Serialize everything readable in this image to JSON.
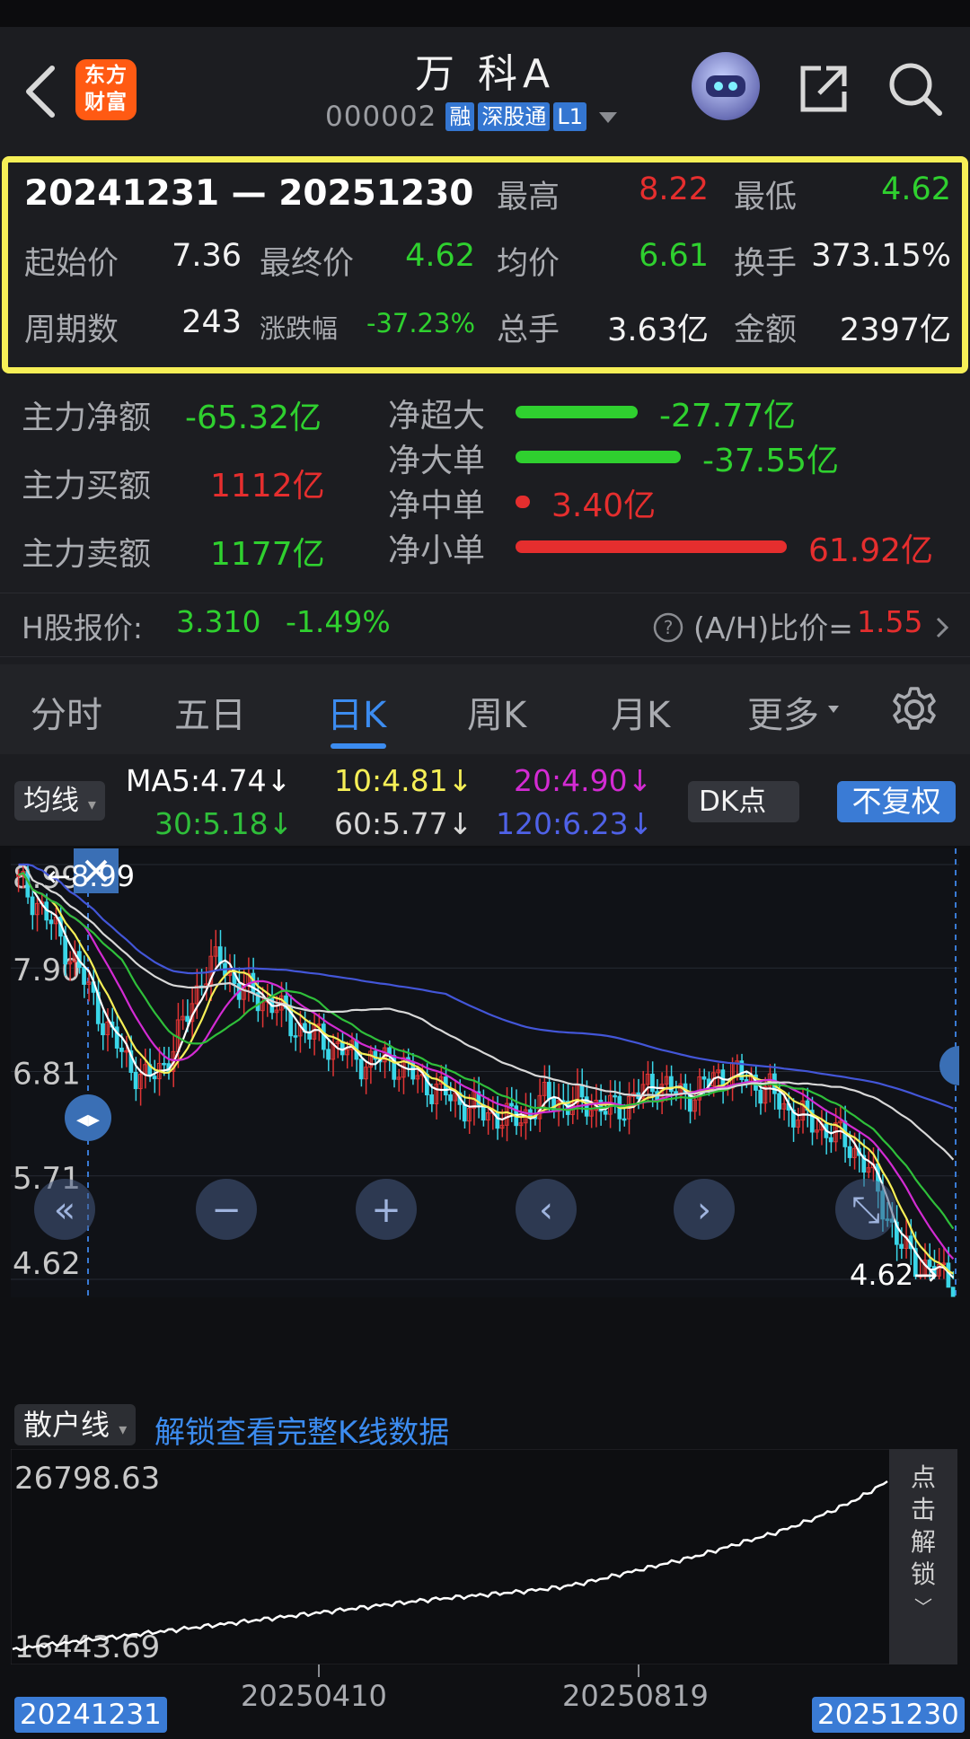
{
  "header": {
    "logo_line1": "东方",
    "logo_line2": "财富",
    "stock_name": "万 科A",
    "stock_code": "000002",
    "tags": [
      "融",
      "深股通",
      "L1"
    ]
  },
  "range": {
    "dates": "20241231 — 20251230",
    "high_label": "最高",
    "high": "8.22",
    "low_label": "最低",
    "low": "4.62",
    "start_label": "起始价",
    "start": "7.36",
    "end_label": "最终价",
    "end": "4.62",
    "avg_label": "均价",
    "avg": "6.61",
    "turnover_label": "换手",
    "turnover": "373.15%",
    "periods_label": "周期数",
    "periods": "243",
    "change_label": "涨跌幅",
    "change": "-37.23%",
    "volume_label": "总手",
    "volume": "3.63亿",
    "amount_label": "金额",
    "amount": "2397亿"
  },
  "flow": {
    "main_net_label": "主力净额",
    "main_net": "-65.32亿",
    "main_buy_label": "主力买额",
    "main_buy": "1112亿",
    "main_sell_label": "主力卖额",
    "main_sell": "1177亿",
    "items": [
      {
        "label": "净超大",
        "value": "-27.77亿",
        "color": "#2fd02f",
        "amount": -27.77
      },
      {
        "label": "净大单",
        "value": "-37.55亿",
        "color": "#2fd02f",
        "amount": -37.55
      },
      {
        "label": "净中单",
        "value": "3.40亿",
        "color": "#e52e2e",
        "amount": 3.4
      },
      {
        "label": "净小单",
        "value": "61.92亿",
        "color": "#e52e2e",
        "amount": 61.92
      }
    ]
  },
  "hshare": {
    "label": "H股报价:",
    "price": "3.310",
    "change": "-1.49%",
    "ratio_label": "(A/H)比价=",
    "ratio": "1.55"
  },
  "tabs": [
    "分时",
    "五日",
    "日K",
    "周K",
    "月K",
    "更多"
  ],
  "active_tab": 2,
  "ma": {
    "select_label": "均线",
    "ma5": "MA5:4.74↓",
    "ma10": "10:4.81↓",
    "ma20": "20:4.90↓",
    "ma30": "30:5.18↓",
    "ma60": "60:5.77↓",
    "ma120": "120:6.23↓",
    "dk_label": "DK点",
    "fq_label": "不复权",
    "colors": {
      "ma5": "#ffffff",
      "ma10": "#f6ef57",
      "ma20": "#d32bd3",
      "ma30": "#2fbf3a",
      "ma60": "#d8d8d8",
      "ma120": "#4356d8"
    }
  },
  "chart_data": {
    "type": "candlestick",
    "y_ticks": [
      "8.99",
      "7.90",
      "6.81",
      "5.71",
      "4.62"
    ],
    "ylim": [
      4.62,
      8.99
    ],
    "high_marker": "8.99",
    "low_marker": "4.62",
    "close_approx": [
      8.8,
      8.6,
      8.3,
      8.0,
      7.6,
      7.2,
      6.9,
      6.7,
      6.9,
      7.3,
      7.8,
      8.0,
      7.7,
      7.6,
      7.5,
      7.3,
      7.2,
      7.1,
      7.0,
      6.9,
      6.95,
      6.85,
      6.7,
      6.6,
      6.5,
      6.4,
      6.35,
      6.3,
      6.4,
      6.55,
      6.45,
      6.5,
      6.4,
      6.45,
      6.6,
      6.7,
      6.55,
      6.6,
      6.75,
      6.8,
      6.7,
      6.6,
      6.4,
      6.3,
      6.2,
      6.1,
      5.9,
      5.5,
      5.0,
      4.8,
      4.7,
      4.62
    ]
  },
  "retail": {
    "select_label": "散户线",
    "unlock_link": "解锁查看完整K线数据",
    "max_label": "26798.63",
    "min_label": "16443.69",
    "unlock_side": [
      "点",
      "击",
      "解",
      "锁"
    ],
    "values": [
      16443.69,
      16700,
      16900,
      17100,
      17300,
      17500,
      17700,
      17900,
      18100,
      18300,
      18500,
      18700,
      18900,
      19100,
      19300,
      19500,
      19650,
      19800,
      19950,
      20100,
      20300,
      20600,
      21000,
      21400,
      21800,
      22200,
      22700,
      23200,
      23700,
      24300,
      25000,
      25800,
      26798.63
    ]
  },
  "dates": {
    "start": "20241231",
    "mid1": "20250410",
    "mid2": "20250819",
    "end": "20251230"
  }
}
